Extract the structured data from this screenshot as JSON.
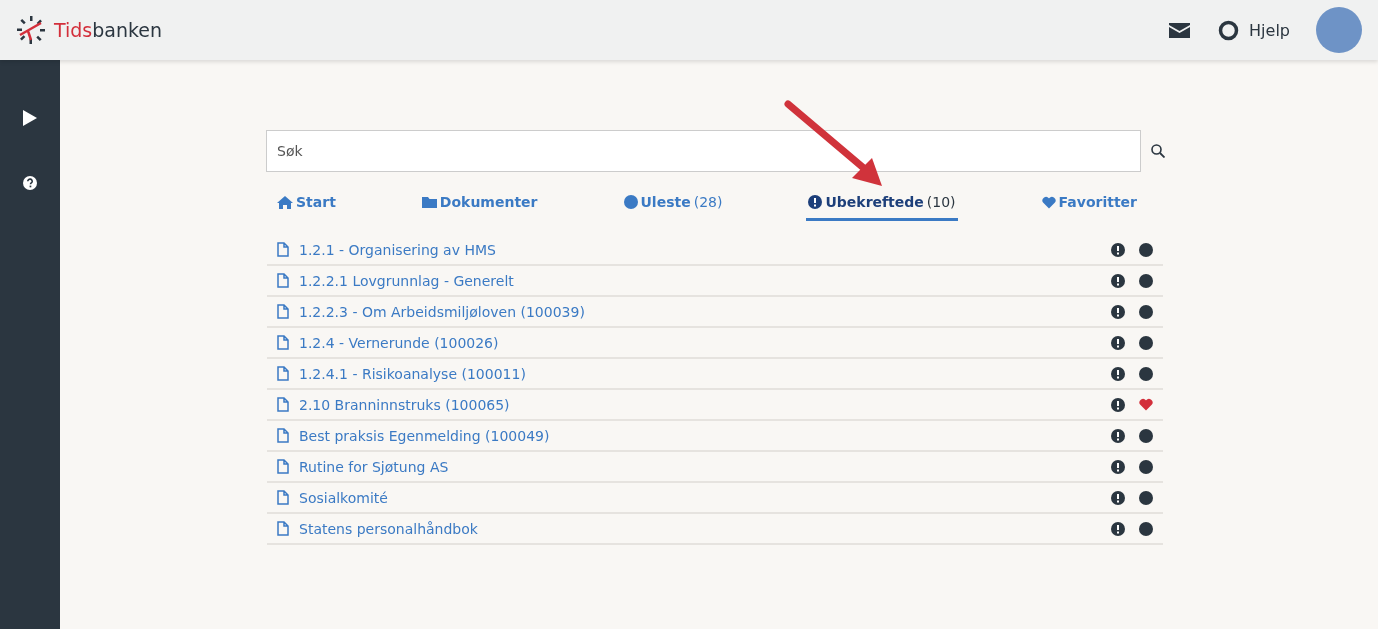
{
  "header": {
    "brand_first": "Tids",
    "brand_second": "banken",
    "help": "Hjelp"
  },
  "search": {
    "placeholder": "Søk"
  },
  "tabs": [
    {
      "kind": "home",
      "label": "Start",
      "selected": false
    },
    {
      "kind": "folder",
      "label": "Dokumenter",
      "selected": false
    },
    {
      "kind": "unread",
      "label": "Uleste",
      "count": "(28)",
      "selected": false
    },
    {
      "kind": "unconfirmed",
      "label": "Ubekreftede",
      "count": "(10)",
      "selected": true
    },
    {
      "kind": "favorites",
      "label": "Favoritter",
      "selected": false
    }
  ],
  "documents": [
    {
      "title": "1.2.1 - Organisering av HMS",
      "favorite": false
    },
    {
      "title": "1.2.2.1 Lovgrunnlag - Generelt",
      "favorite": false
    },
    {
      "title": "1.2.2.3 - Om Arbeidsmiljøloven (100039)",
      "favorite": false
    },
    {
      "title": "1.2.4 - Vernerunde (100026)",
      "favorite": false
    },
    {
      "title": "1.2.4.1 - Risikoanalyse (100011)",
      "favorite": false
    },
    {
      "title": "2.10 Branninnstruks (100065)",
      "favorite": true
    },
    {
      "title": "Best praksis Egenmelding (100049)",
      "favorite": false
    },
    {
      "title": "Rutine for Sjøtung AS",
      "favorite": false
    },
    {
      "title": "Sosialkomité",
      "favorite": false
    },
    {
      "title": "Statens personalhåndbok",
      "favorite": false
    }
  ]
}
